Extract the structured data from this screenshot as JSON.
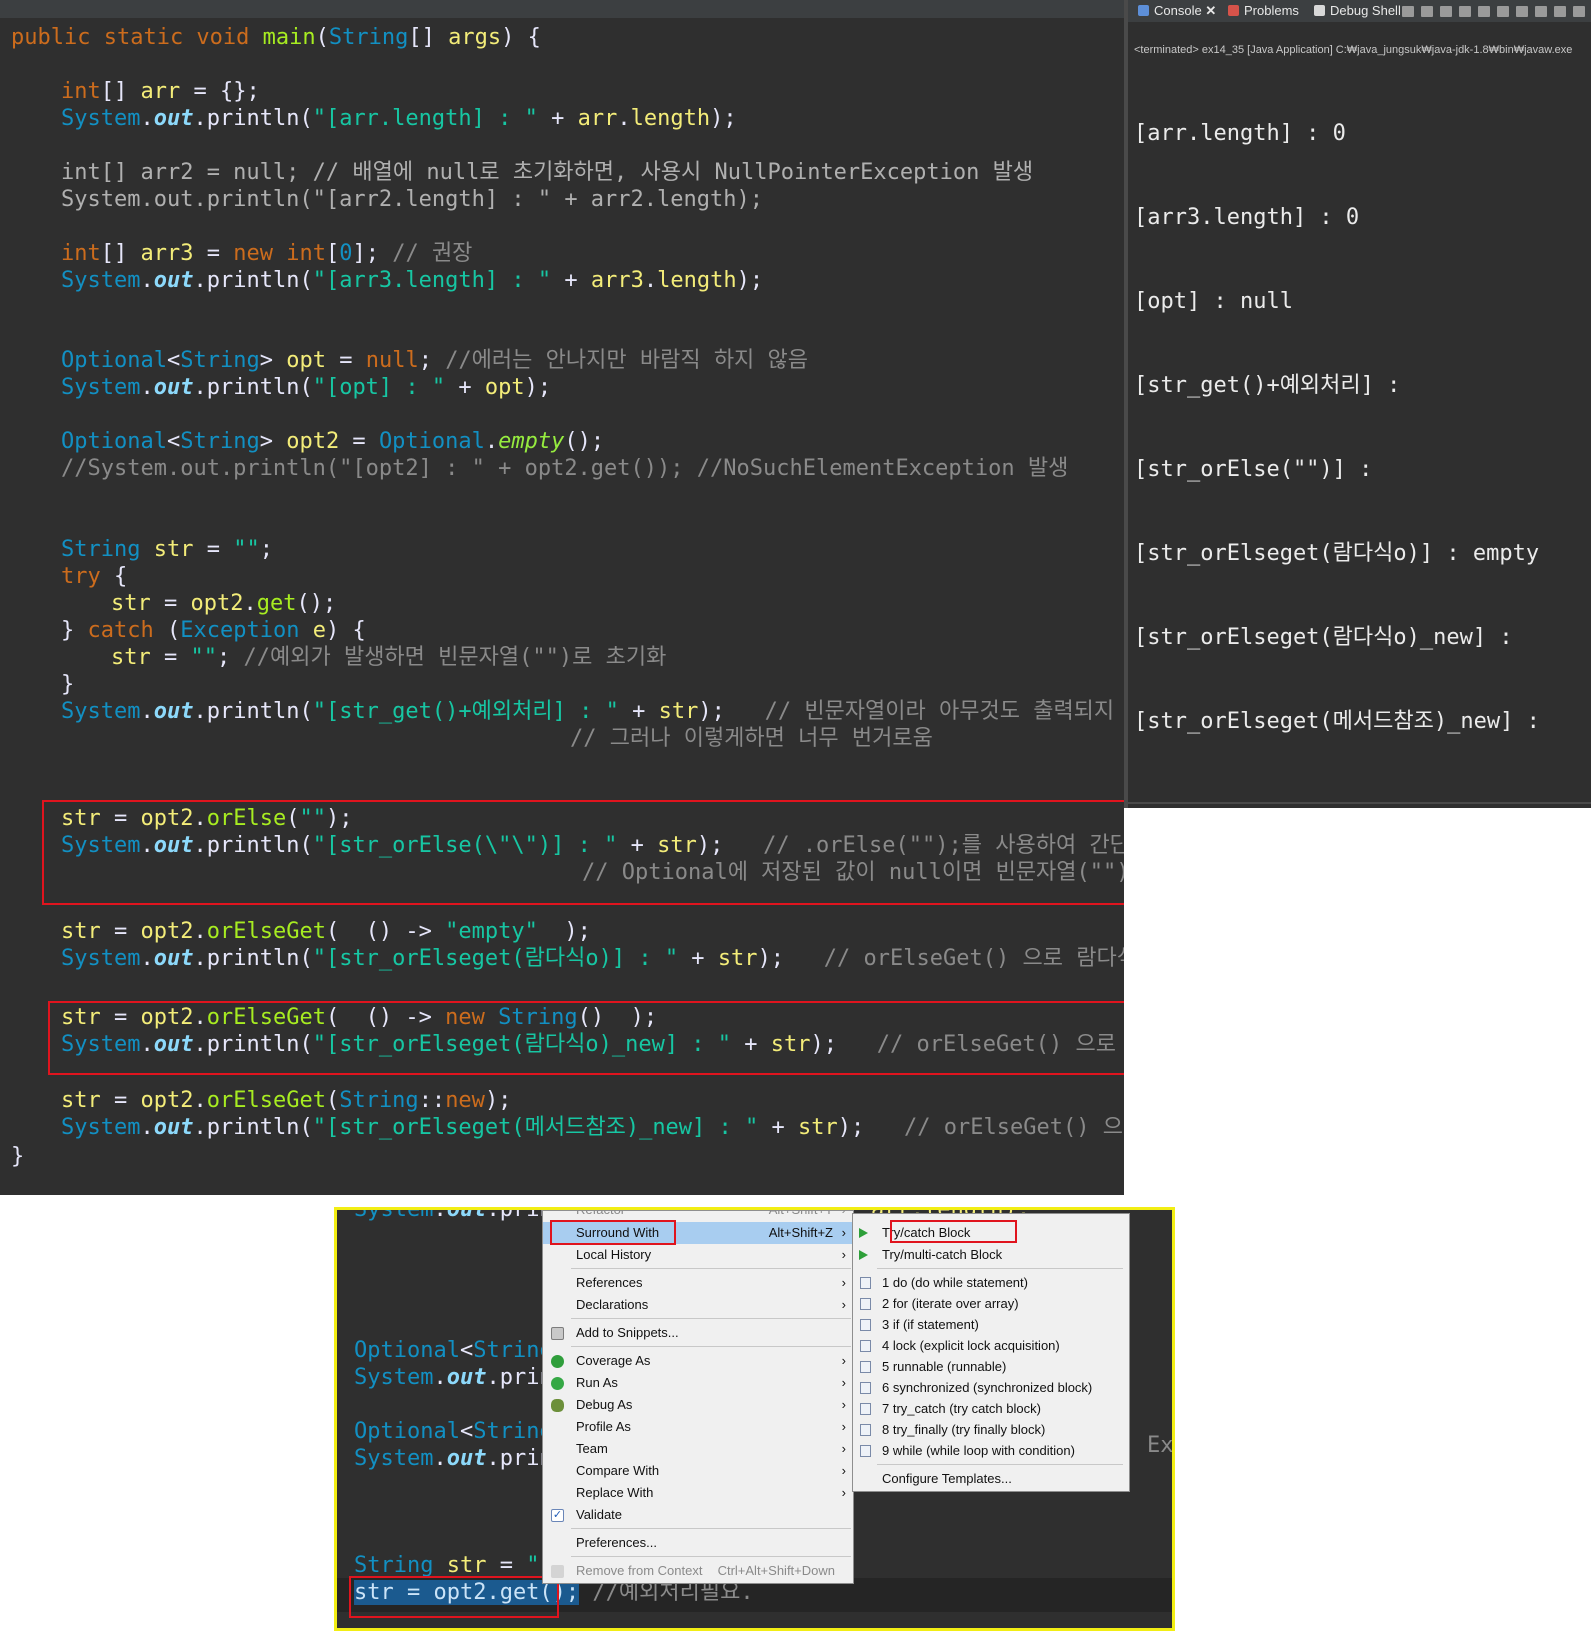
{
  "editor": {
    "line_main": "public static void main(String[] args) {",
    "line_arr": "int[] arr = {};",
    "line_arr_print": "System.out.println(\"[arr.length] : \" + arr.length);",
    "line_arr2": "int[] arr2 = null; // 배열에 null로 초기화하면, 사용시 NullPointerException 발생",
    "line_arr2_print": "System.out.println(\"[arr2.length] : \" + arr2.length);",
    "line_arr3": "int[] arr3 = new int[0]; // 권장",
    "line_arr3_print": "System.out.println(\"[arr3.length] : \" + arr3.length);",
    "line_opt": "Optional<String> opt = null; //에러는 안나지만 바람직 하지 않음",
    "line_opt_print": "System.out.println(\"[opt] : \" + opt);",
    "line_opt2": "Optional<String> opt2 = Optional.empty();",
    "line_opt2_comment": "//System.out.println(\"[opt2] : \" + opt2.get()); //NoSuchElementException 발생",
    "line_str": "String str = \"\";",
    "line_try": "try {",
    "line_get": "str = opt2.get();",
    "line_catch": "} catch (Exception e) {",
    "line_catch_body": "str = \"\"; //예외가 발생하면 빈문자열(\"\")로 초기화",
    "line_close": "}",
    "line_get_print": "System.out.println(\"[str_get()+예외처리] : \" + str);   // 빈문자열이라 아무것도 출력되지 않음",
    "line_get_print2": "// 그러나 이렇게하면 너무 번거로움",
    "line_orelse": "str = opt2.orElse(\"\");",
    "line_orelse_print": "System.out.println(\"[str_orElse(\\\"\\\")] : \" + str);   // .orElse(\"\");를 사용하여 간단히 처리가능",
    "line_orelse_print2": "// Optional에 저장된 값이 null이면 빈문자열(\"\") 반환",
    "line_orelseget1": "str = opt2.orElseGet(  () -> \"empty\"  );",
    "line_orelseget1_print": "System.out.println(\"[str_orElseget(람다식o)] : \" + str);   // orElseGet() 으로 람다식 사용",
    "line_orelseget2": "str = opt2.orElseGet(  () -> new String()  );",
    "line_orelseget2_print": "System.out.println(\"[str_orElseget(람다식o)_new] : \" + str);   // orElseGet() 으로 람다식 사용",
    "line_orelseget3": "str = opt2.orElseGet(String::new);",
    "line_orelseget3_print": "System.out.println(\"[str_orElseget(메서드참조)_new] : \" + str);   // orElseGet() 으로 람다식 사용",
    "line_end": "}"
  },
  "console": {
    "tabs": [
      "Console",
      "Problems",
      "Debug Shell"
    ],
    "status": "<terminated> ex14_35 [Java Application] C:₩java_jungsuk₩java-jdk-1.8₩bin₩javaw.exe",
    "output": [
      "[arr.length] : 0",
      "[arr3.length] : 0",
      "[opt] : null",
      "[str_get()+예외처리] :",
      "[str_orElse(\"\")] :",
      "[str_orElseget(람다식o)] : empty",
      "[str_orElseget(람다식o)_new] :",
      "[str_orElseget(메서드참조)_new] :"
    ]
  },
  "screenshot2": {
    "bg_code": {
      "line_top": "System.out.prin",
      "line_opt": "Optional<String",
      "line_opt_print": "System.out.prin",
      "line_opt2": "Optional<String",
      "line_opt2_print": "System.out.prin",
      "line_str": "String str = \"\"",
      "line_get": "str = opt2.get();",
      "line_get_comment": " //예외처리필요.",
      "peek_right": "arr.length);",
      "peek_ex": "Ex"
    },
    "context_menu": {
      "top_cut": "Refactor",
      "top_cut_shortcut": "Alt+Shift+T",
      "items": [
        {
          "label": "Surround With",
          "shortcut": "Alt+Shift+Z",
          "icon": "",
          "submenu": true
        },
        {
          "label": "Local History",
          "shortcut": "",
          "icon": "",
          "submenu": true
        },
        {
          "label": "References",
          "shortcut": "",
          "icon": "",
          "submenu": true
        },
        {
          "label": "Declarations",
          "shortcut": "",
          "icon": "",
          "submenu": true
        },
        {
          "label": "Add to Snippets...",
          "shortcut": "",
          "icon": "snippet-icon",
          "submenu": false
        },
        {
          "label": "Coverage As",
          "shortcut": "",
          "icon": "coverage-icon",
          "submenu": true
        },
        {
          "label": "Run As",
          "shortcut": "",
          "icon": "run-icon",
          "submenu": true
        },
        {
          "label": "Debug As",
          "shortcut": "",
          "icon": "debug-bug-icon",
          "submenu": true
        },
        {
          "label": "Profile As",
          "shortcut": "",
          "icon": "",
          "submenu": true
        },
        {
          "label": "Team",
          "shortcut": "",
          "icon": "",
          "submenu": true
        },
        {
          "label": "Compare With",
          "shortcut": "",
          "icon": "",
          "submenu": true
        },
        {
          "label": "Replace With",
          "shortcut": "",
          "icon": "",
          "submenu": true
        },
        {
          "label": "Validate",
          "shortcut": "",
          "icon": "checkbox-icon",
          "submenu": false
        },
        {
          "label": "Preferences...",
          "shortcut": "",
          "icon": "",
          "submenu": false
        },
        {
          "label": "Remove from Context",
          "shortcut": "Ctrl+Alt+Shift+Down",
          "icon": "remove-context-icon",
          "submenu": false
        }
      ]
    },
    "submenu": {
      "items": [
        "Try/catch Block",
        "Try/multi-catch Block",
        "1 do (do while statement)",
        "2 for (iterate over array)",
        "3 if (if statement)",
        "4 lock (explicit lock acquisition)",
        "5 runnable (runnable)",
        "6 synchronized (synchronized block)",
        "7 try_catch (try catch block)",
        "8 try_finally (try finally block)",
        "9 while (while loop with condition)",
        "Configure Templates..."
      ]
    }
  },
  "colors": {
    "editor_bg": "#2f2f2f",
    "keyword": "#cc6c1d",
    "type": "#1290c3",
    "string": "#17c6a3",
    "comment": "#8a8a8a",
    "highlight_box": "#e0141e",
    "screenshot_border": "#f2ee14",
    "menu_bg": "#f0f0f0",
    "menu_active": "#a8cdf0"
  }
}
